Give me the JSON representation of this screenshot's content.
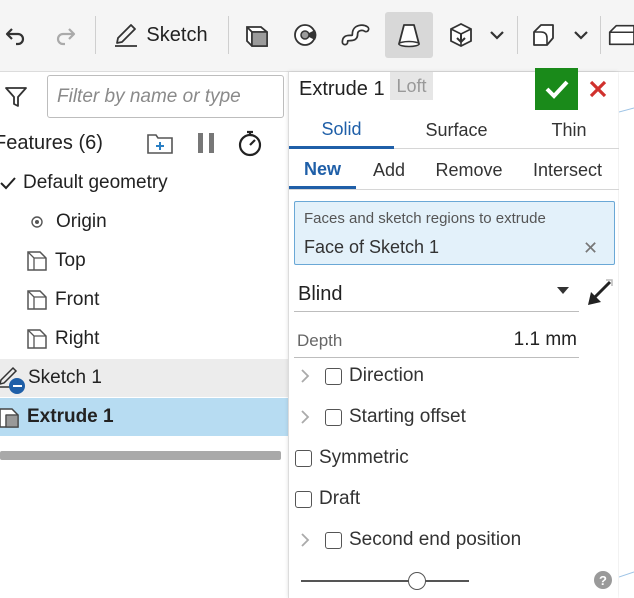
{
  "toolbar": {
    "sketch_label": "Sketch",
    "tools": [
      "undo-icon",
      "redo-icon",
      "sketch-pencil-icon",
      "new-sketch-plane-icon",
      "revolve-icon",
      "sweep-icon",
      "loft-icon",
      "extrude-icon",
      "chevron-down-icon",
      "fillet-icon",
      "chevron-down-icon",
      "chamfer-icon"
    ]
  },
  "tree": {
    "filter_placeholder": "Filter by name or type",
    "features_title": "Features (6)",
    "items": [
      {
        "label": "Default geometry",
        "icon": "check-icon"
      },
      {
        "label": "Origin",
        "icon": "origin-icon"
      },
      {
        "label": "Top",
        "icon": "plane-icon"
      },
      {
        "label": "Front",
        "icon": "plane-icon"
      },
      {
        "label": "Right",
        "icon": "plane-icon"
      },
      {
        "label": "Sketch 1",
        "icon": "sketch-icon"
      },
      {
        "label": "Extrude 1",
        "icon": "extrude-feature-icon"
      }
    ]
  },
  "dialog": {
    "title": "Extrude 1",
    "loft_tag": "Loft",
    "body_tabs": [
      "Solid",
      "Surface",
      "Thin"
    ],
    "op_tabs": [
      "New",
      "Add",
      "Remove",
      "Intersect"
    ],
    "faces_label": "Faces and sketch regions to extrude",
    "faces_value": "Face of Sketch 1",
    "end_type": "Blind",
    "depth_label": "Depth",
    "depth_value": "1.1 mm",
    "options": {
      "direction": "Direction",
      "starting_offset": "Starting offset",
      "symmetric": "Symmetric",
      "draft": "Draft",
      "second_end": "Second end position"
    },
    "help": "?"
  },
  "colors": {
    "accent": "#1f5fa8",
    "ok_green": "#1a8a1a",
    "cancel_red": "#d0312d",
    "selected_row": "#b7dcf2",
    "selection_box": "#e3f1fa"
  }
}
